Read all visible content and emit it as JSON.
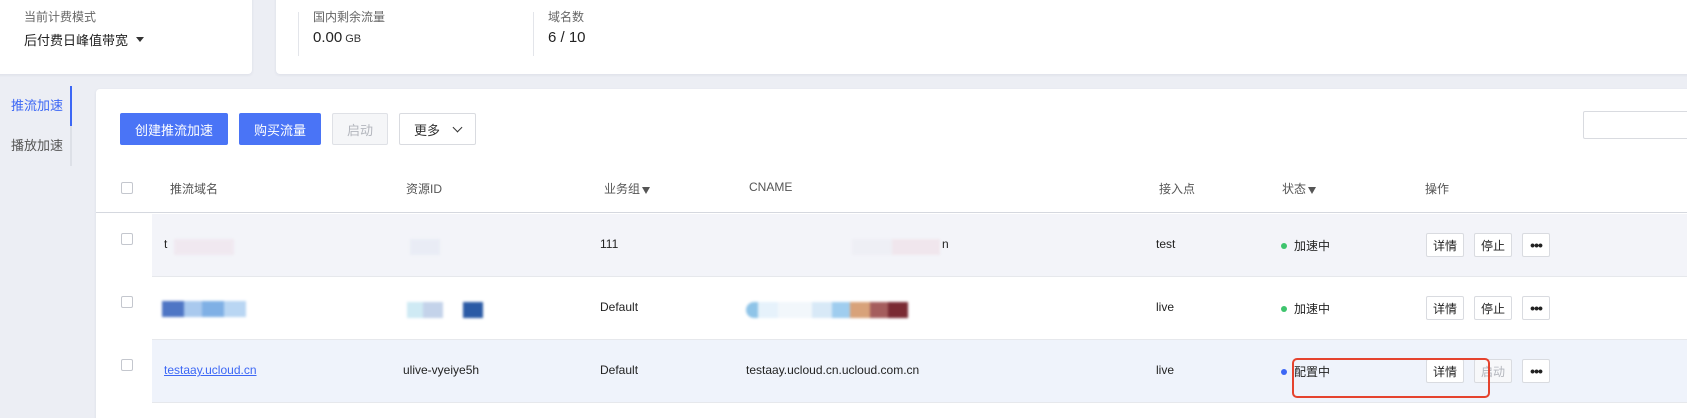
{
  "billing": {
    "label": "当前计费模式",
    "value": "后付费日峰值带宽"
  },
  "stats": [
    {
      "label": "国内剩余流量",
      "value": "0.00",
      "unit": "GB"
    },
    {
      "label": "域名数",
      "value": "6 / 10",
      "unit": ""
    }
  ],
  "sidebar": {
    "items": [
      {
        "label": "推流加速",
        "active": true
      },
      {
        "label": "播放加速",
        "active": false
      }
    ]
  },
  "toolbar": {
    "create_label": "创建推流加速",
    "buy_label": "购买流量",
    "start_label": "启动",
    "more_label": "更多"
  },
  "table": {
    "headers": {
      "domain": "推流域名",
      "resource_id": "资源ID",
      "group": "业务组",
      "cname": "CNAME",
      "access_point": "接入点",
      "status": "状态",
      "actions": "操作"
    },
    "rows": [
      {
        "domain": "t",
        "resource_id": "",
        "group": "111",
        "cname": "n",
        "access_point": "test",
        "status": "加速中",
        "status_color": "#3ec46d",
        "action_primary": "详情",
        "action_secondary": "停止",
        "secondary_disabled": false,
        "more": "•••"
      },
      {
        "domain": "",
        "resource_id": "",
        "group": "Default",
        "cname": "",
        "access_point": "live",
        "status": "加速中",
        "status_color": "#3ec46d",
        "action_primary": "详情",
        "action_secondary": "停止",
        "secondary_disabled": false,
        "more": "•••"
      },
      {
        "domain": "testaay.ucloud.cn",
        "resource_id": "ulive-vyeiye5h",
        "group": "Default",
        "cname": "testaay.ucloud.cn.ucloud.com.cn",
        "access_point": "live",
        "status": "配置中",
        "status_color": "#3c67f5",
        "action_primary": "详情",
        "action_secondary": "启动",
        "secondary_disabled": true,
        "more": "•••"
      }
    ]
  },
  "colors": {
    "accent": "#4a74f6",
    "highlight": "#e5432e"
  }
}
